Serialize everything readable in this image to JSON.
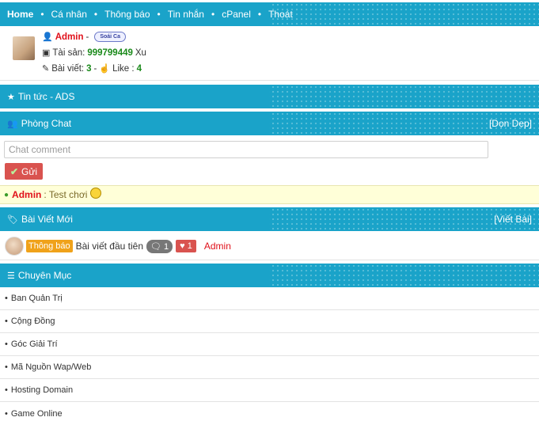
{
  "nav": {
    "items": [
      "Home",
      "Cá nhân",
      "Thông báo",
      "Tin nhắn",
      "cPanel",
      "Thoát"
    ],
    "separator": "•"
  },
  "profile": {
    "name": "Admin",
    "dash": "-",
    "badge": "Soái Ca",
    "coins_label": "Tài sản:",
    "coins_value": "999799449",
    "coins_unit": "Xu",
    "posts_label": "Bài viết:",
    "posts_value": "3",
    "likes_label": "Like :",
    "likes_value": "4"
  },
  "news": {
    "title": "Tin tức - ADS"
  },
  "chat": {
    "title": "Phòng Chat",
    "action": "[Dọn Dẹp]",
    "placeholder": "Chat comment",
    "send_label": "Gửi",
    "message_user": "Admin",
    "message_text": ": Test chơi"
  },
  "posts": {
    "title": "Bài Viết Mới",
    "action": "[Viết Bài]",
    "items": [
      {
        "tag": "Thông báo",
        "title": "Bài viết đầu tiên",
        "comments": "1",
        "likes": "1",
        "author": "Admin"
      }
    ]
  },
  "categories": {
    "title": "Chuyên Mục",
    "items": [
      "Ban Quản Trị",
      "Cộng Đồng",
      "Góc Giải Trí",
      "Mã Nguồn Wap/Web",
      "Hosting Domain",
      "Game Online"
    ]
  },
  "colors": {
    "bar": "#1aa3c9",
    "danger": "#d9534f",
    "accent_red": "#e0101a",
    "value_green": "#1b8a1b",
    "tag_orange": "#f0a21a"
  },
  "icons": [
    "user-icon",
    "wallet-icon",
    "pencil-icon",
    "thumbs-up-icon",
    "star-icon",
    "users-icon",
    "check-icon",
    "smiley-icon",
    "tags-icon",
    "comment-icon",
    "heart-icon",
    "list-icon"
  ]
}
